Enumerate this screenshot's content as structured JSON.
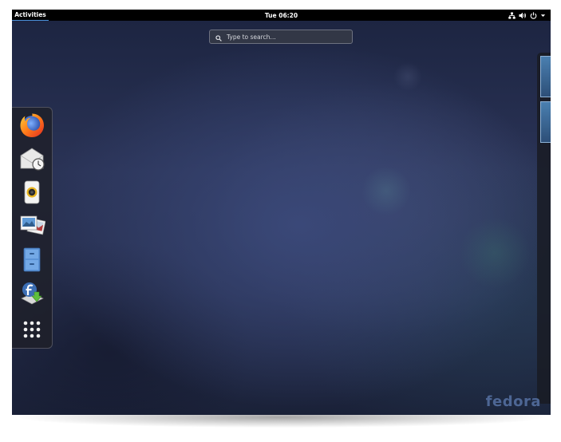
{
  "topbar": {
    "activities_label": "Activities",
    "clock": "Tue 06:20",
    "status_icons": [
      "network-icon",
      "volume-icon",
      "power-icon",
      "chevron-down-icon"
    ]
  },
  "search": {
    "placeholder": "Type to search…",
    "icon": "search-icon"
  },
  "dash": {
    "items": [
      {
        "name": "Firefox",
        "icon": "firefox-icon"
      },
      {
        "name": "Evolution",
        "icon": "mail-clock-icon"
      },
      {
        "name": "Rhythmbox",
        "icon": "speaker-icon"
      },
      {
        "name": "Photos",
        "icon": "photos-icon"
      },
      {
        "name": "Files",
        "icon": "file-cabinet-icon"
      },
      {
        "name": "Software",
        "icon": "fedora-software-icon"
      },
      {
        "name": "Show Applications",
        "icon": "app-grid-icon"
      }
    ]
  },
  "watermark": {
    "text": "fedora"
  },
  "colors": {
    "accent": "#4a90d9",
    "topbar": "#000000",
    "wallpaper": "#2a3356"
  }
}
